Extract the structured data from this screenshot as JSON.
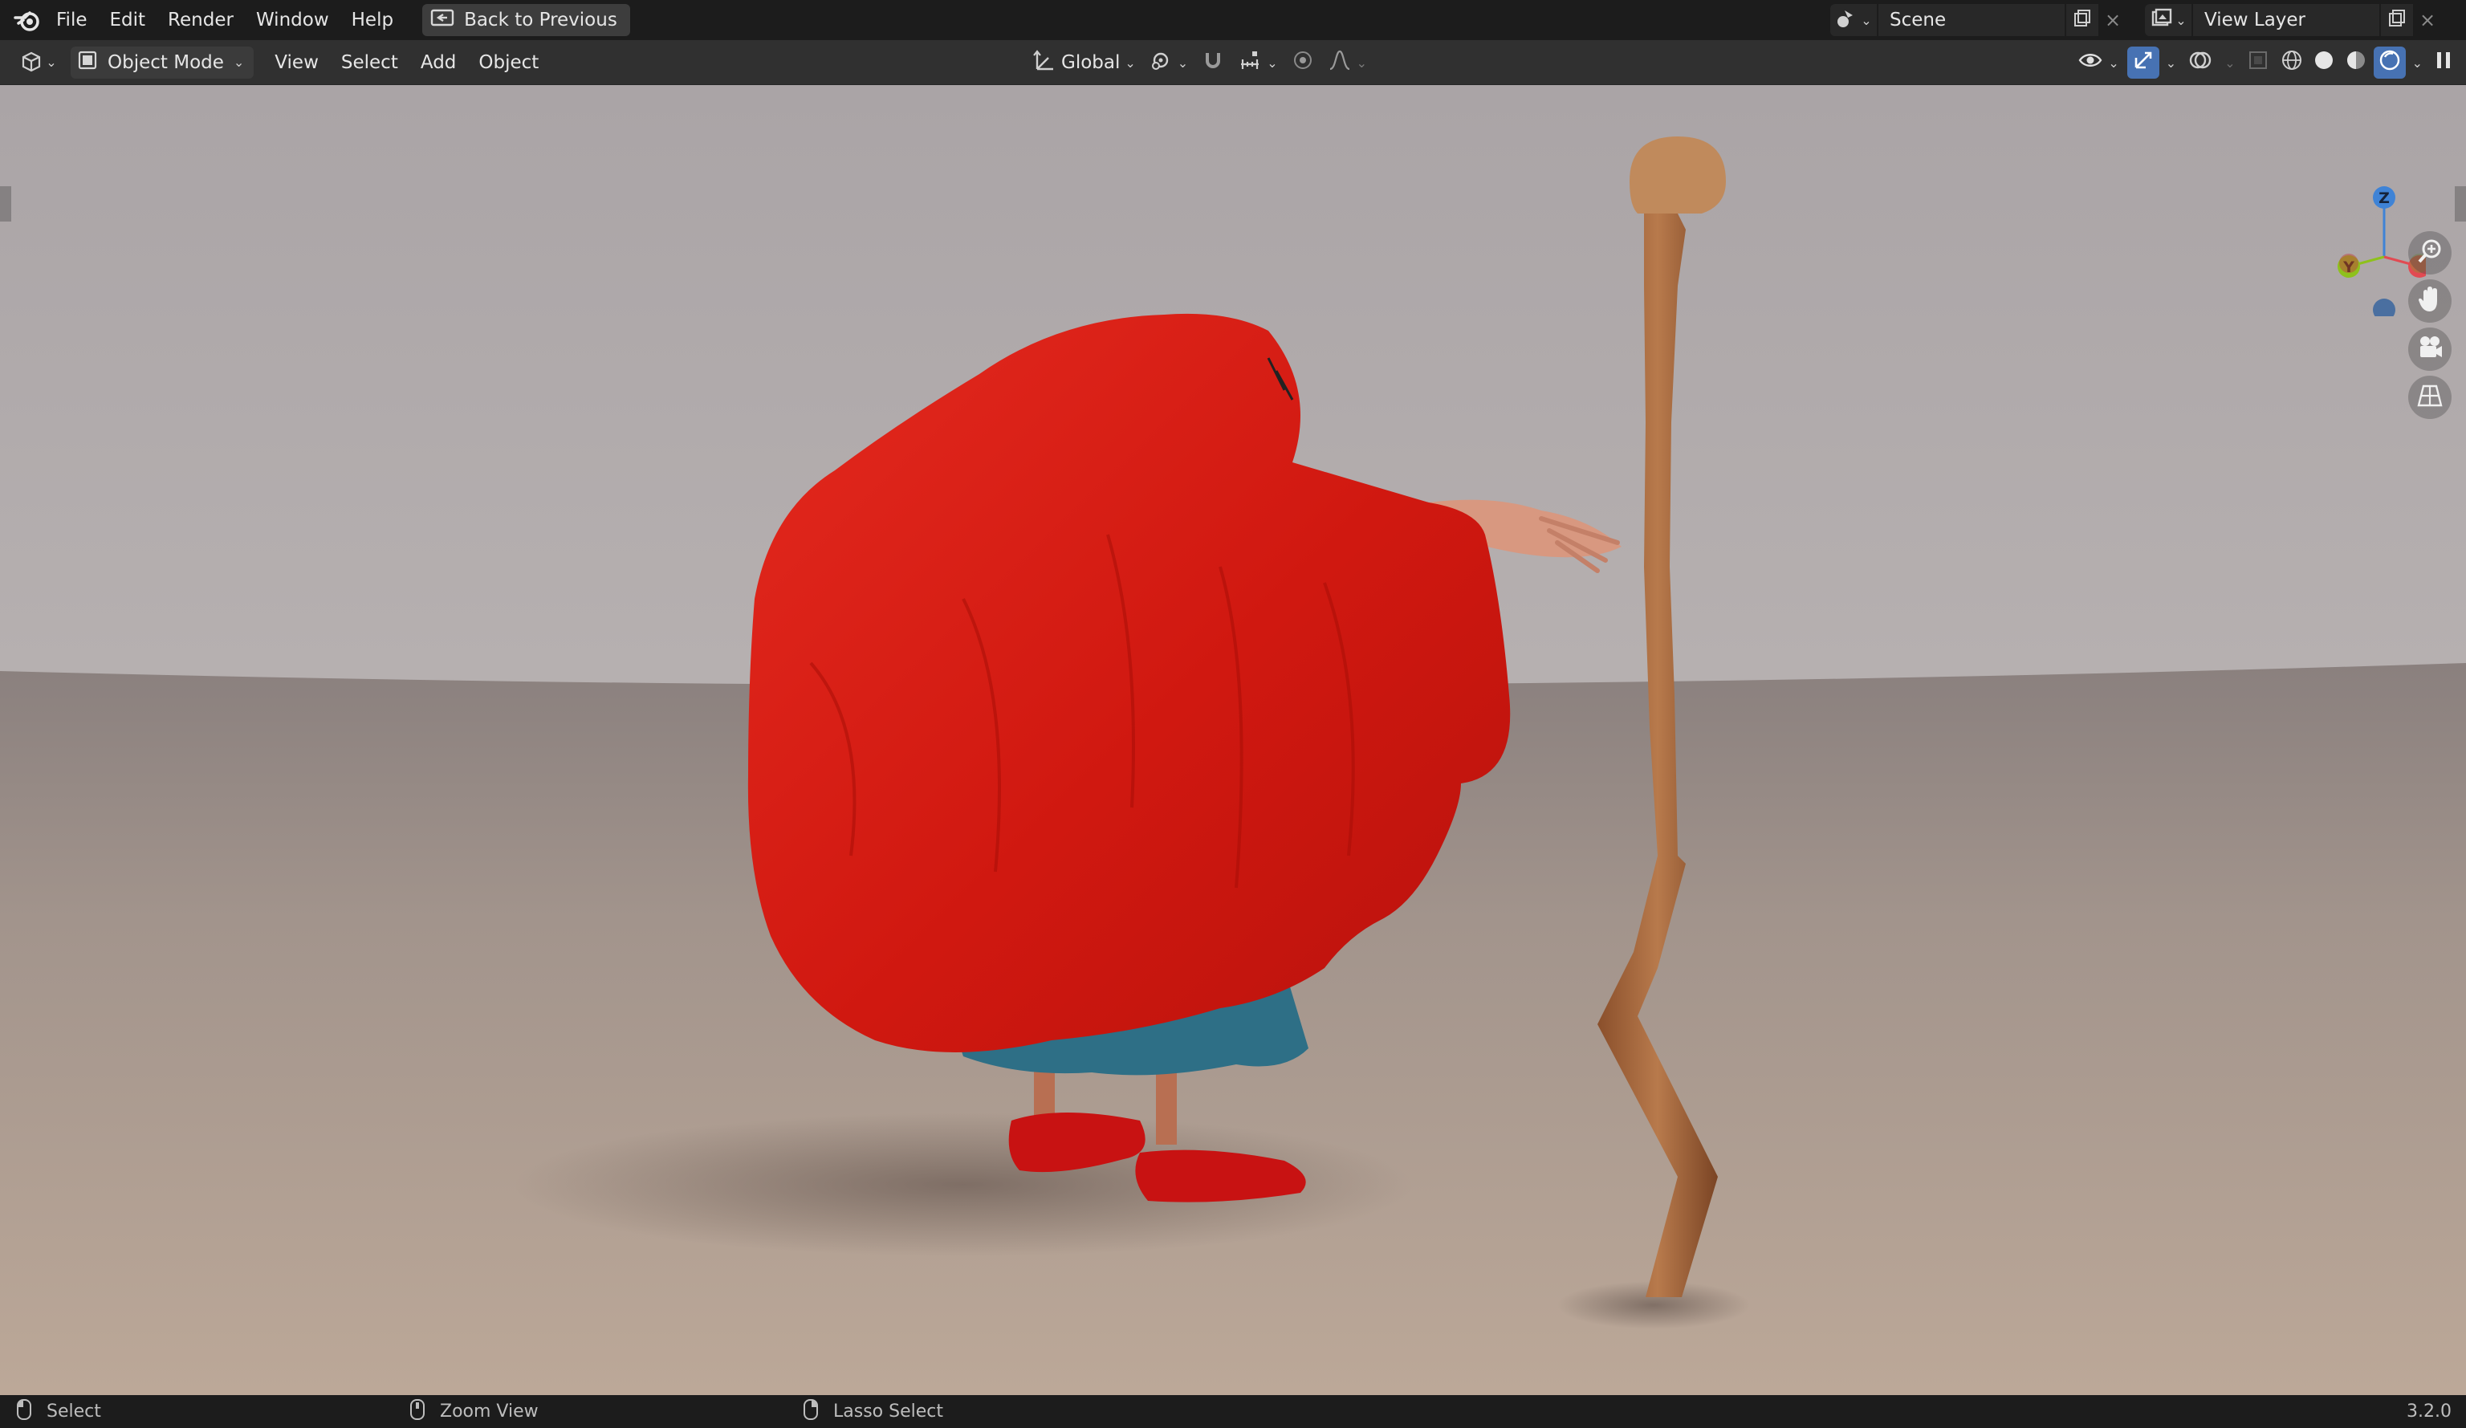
{
  "menubar": {
    "items": [
      "File",
      "Edit",
      "Render",
      "Window",
      "Help"
    ],
    "back_button": "Back to Previous",
    "scene_name": "Scene",
    "view_layer_name": "View Layer"
  },
  "header": {
    "mode": "Object Mode",
    "menus": [
      "View",
      "Select",
      "Add",
      "Object"
    ],
    "transform_orientation": "Global"
  },
  "viewport": {
    "gizmo_axes": {
      "z": "Z",
      "y": "Y"
    },
    "colors": {
      "x_axis": "#e24a52",
      "y_axis": "#8ec11c",
      "z_axis": "#3f83d6",
      "cloak": "#d81a14",
      "skirt": "#2e6f86",
      "staff": "#a5643a"
    }
  },
  "statusbar": {
    "left": "Select",
    "middle": "Zoom View",
    "right": "Lasso Select",
    "version": "3.2.0"
  },
  "icons": {
    "logo": "blender-logo-icon",
    "zoom": "zoom-icon",
    "pan": "hand-icon",
    "camera": "camera-icon",
    "ortho": "grid-icon"
  }
}
